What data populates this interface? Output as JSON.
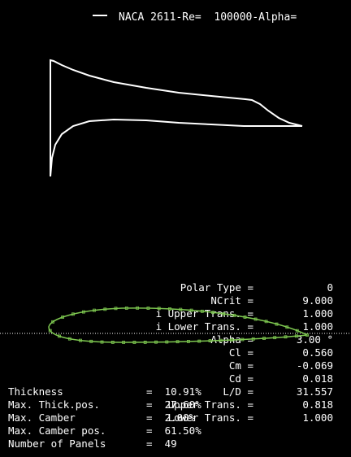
{
  "legend": {
    "label": "NACA 2611-Re=  100000-Alpha="
  },
  "params": [
    {
      "label": "Polar Type =",
      "value": "0"
    },
    {
      "label": "NCrit =",
      "value": "9.000"
    },
    {
      "label": "i Upper Trans. =",
      "value": "1.000"
    },
    {
      "label": "i Lower Trans. =",
      "value": "1.000"
    },
    {
      "label": "Alpha =",
      "value": "3.00 °"
    },
    {
      "label": "Cl =",
      "value": "0.560"
    },
    {
      "label": "Cm =",
      "value": "-0.069"
    },
    {
      "label": "Cd =",
      "value": "0.018"
    },
    {
      "label": "L/D =",
      "value": "31.557"
    },
    {
      "label": "Upper Trans. =",
      "value": "0.818"
    },
    {
      "label": "Lower Trans. =",
      "value": "1.000"
    }
  ],
  "geometry": [
    {
      "label": "Thickness",
      "value": "=  10.91%"
    },
    {
      "label": "Max. Thick.pos.",
      "value": "=  27.60%"
    },
    {
      "label": "Max. Camber",
      "value": "=  2.00%"
    },
    {
      "label": "Max. Camber pos.",
      "value": "=  61.50%"
    },
    {
      "label": "Number of Panels",
      "value": "=  49"
    }
  ],
  "colors": {
    "background": "#000000",
    "curve": "#ffffff",
    "airfoil": "#7ec850",
    "axis": "#ffffff"
  }
}
